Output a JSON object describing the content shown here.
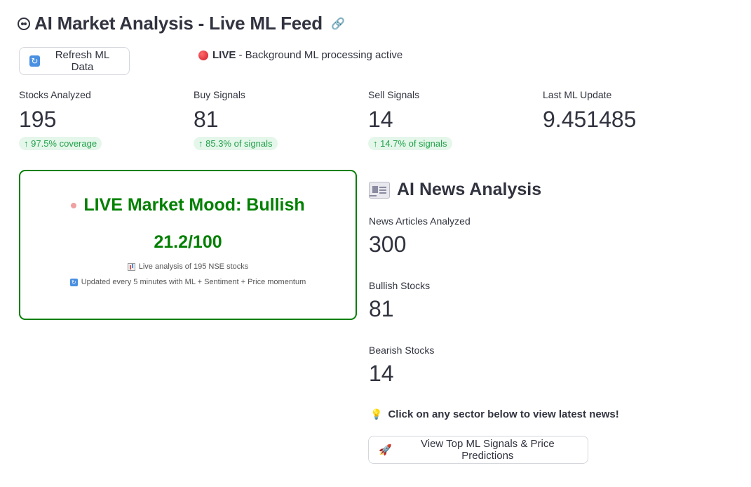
{
  "header": {
    "title": "AI Market Analysis - Live ML Feed",
    "title_icon": "robot-mask-icon",
    "link_icon": "link-icon"
  },
  "controls": {
    "refresh_label": "Refresh ML Data",
    "refresh_icon": "refresh-icon",
    "live_badge": "LIVE",
    "live_text": " - Background ML processing active"
  },
  "metrics": [
    {
      "label": "Stocks Analyzed",
      "value": "195",
      "delta": "97.5% coverage"
    },
    {
      "label": "Buy Signals",
      "value": "81",
      "delta": "85.3% of signals"
    },
    {
      "label": "Sell Signals",
      "value": "14",
      "delta": "14.7% of signals"
    },
    {
      "label": "Last ML Update",
      "value": "9.451485",
      "delta": ""
    }
  ],
  "mood": {
    "title": "LIVE Market Mood: Bullish",
    "score": "21.2/100",
    "line1": "Live analysis of 195 NSE stocks",
    "line2": "Updated every 5 minutes with ML + Sentiment + Price momentum",
    "accent": "#008000"
  },
  "news": {
    "title": "AI News Analysis",
    "metrics": [
      {
        "label": "News Articles Analyzed",
        "value": "300"
      },
      {
        "label": "Bullish Stocks",
        "value": "81"
      },
      {
        "label": "Bearish Stocks",
        "value": "14"
      }
    ],
    "tip": "Click on any sector below to view latest news!",
    "signals_button": "View Top ML Signals & Price Predictions"
  },
  "colors": {
    "delta_green": "#21a24a",
    "delta_bg": "#e5f6ea",
    "live_red": "#d11a2a"
  }
}
